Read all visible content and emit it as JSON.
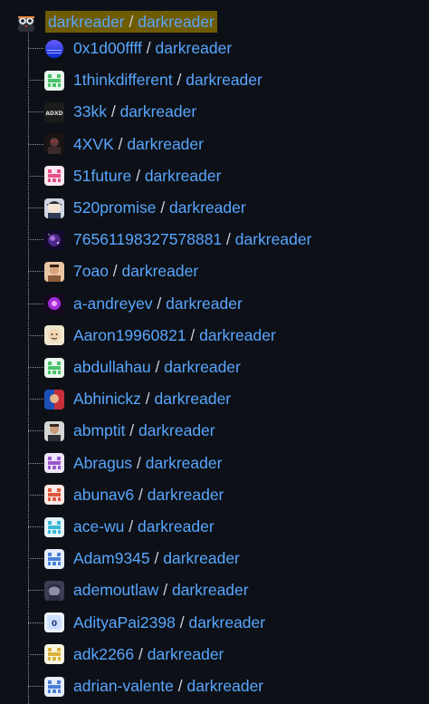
{
  "root": {
    "owner": "darkreader",
    "separator": " / ",
    "repo": "darkreader",
    "avatar_icon": "darkreader-logo-icon"
  },
  "forks": [
    {
      "owner": "0x1d00ffff",
      "repo": "darkreader",
      "avatar": "avatar-gradient-blue"
    },
    {
      "owner": "1thinkdifferent",
      "repo": "darkreader",
      "avatar": "avatar-identicon-green"
    },
    {
      "owner": "33kk",
      "repo": "darkreader",
      "avatar": "avatar-text-logo"
    },
    {
      "owner": "4XVK",
      "repo": "darkreader",
      "avatar": "avatar-photo-dark"
    },
    {
      "owner": "51future",
      "repo": "darkreader",
      "avatar": "avatar-identicon-pink"
    },
    {
      "owner": "520promise",
      "repo": "darkreader",
      "avatar": "avatar-anime"
    },
    {
      "owner": "76561198327578881",
      "repo": "darkreader",
      "avatar": "avatar-galaxy"
    },
    {
      "owner": "7oao",
      "repo": "darkreader",
      "avatar": "avatar-photo-face"
    },
    {
      "owner": "a-andreyev",
      "repo": "darkreader",
      "avatar": "avatar-purple-orb"
    },
    {
      "owner": "Aaron19960821",
      "repo": "darkreader",
      "avatar": "avatar-cartoon"
    },
    {
      "owner": "abdullahau",
      "repo": "darkreader",
      "avatar": "avatar-identicon-green"
    },
    {
      "owner": "Abhinickz",
      "repo": "darkreader",
      "avatar": "avatar-photo-colorful"
    },
    {
      "owner": "abmptit",
      "repo": "darkreader",
      "avatar": "avatar-photo-portrait"
    },
    {
      "owner": "Abragus",
      "repo": "darkreader",
      "avatar": "avatar-identicon-purple"
    },
    {
      "owner": "abunav6",
      "repo": "darkreader",
      "avatar": "avatar-identicon-red"
    },
    {
      "owner": "ace-wu",
      "repo": "darkreader",
      "avatar": "avatar-identicon-cyan"
    },
    {
      "owner": "Adam9345",
      "repo": "darkreader",
      "avatar": "avatar-identicon-blue"
    },
    {
      "owner": "ademoutlaw",
      "repo": "darkreader",
      "avatar": "avatar-anime-dark"
    },
    {
      "owner": "AdityaPai2398",
      "repo": "darkreader",
      "avatar": "avatar-letter-o"
    },
    {
      "owner": "adk2266",
      "repo": "darkreader",
      "avatar": "avatar-identicon-yellow"
    },
    {
      "owner": "adrian-valente",
      "repo": "darkreader",
      "avatar": "avatar-identicon-blue"
    }
  ],
  "colors": {
    "background": "#0d1117",
    "link": "#58a6ff",
    "separator_text": "#c9d1d9",
    "root_highlight": "#6f5b00",
    "tree_line": "#8b949e"
  }
}
